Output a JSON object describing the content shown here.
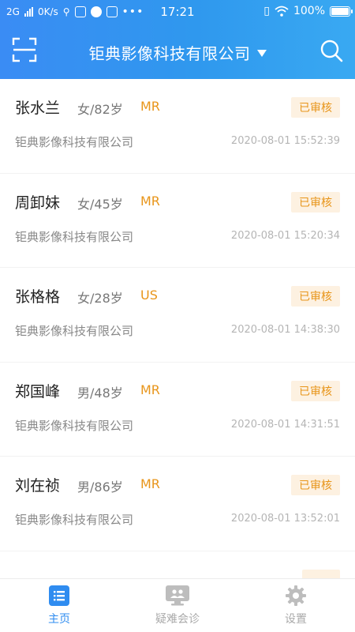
{
  "status_bar": {
    "network": "2G",
    "speed": "0K/s",
    "time": "17:21",
    "battery": "100%"
  },
  "header": {
    "title": "钜典影像科技有限公司"
  },
  "colors": {
    "header_gradient_start": "#3a8cf4",
    "header_gradient_end": "#39a9f2",
    "accent": "#2f8cf0",
    "modality": "#e8951a",
    "badge_bg": "#fdf1e1"
  },
  "icons": {
    "scan": "scan-icon",
    "search": "search-icon",
    "home": "list-icon",
    "consult": "monitor-icon",
    "settings": "gear-icon"
  },
  "records": [
    {
      "name": "张水兰",
      "meta": "女/82岁",
      "modality": "MR",
      "status": "已审核",
      "org": "钜典影像科技有限公司",
      "time": "2020-08-01 15:52:39"
    },
    {
      "name": "周卸妹",
      "meta": "女/45岁",
      "modality": "MR",
      "status": "已审核",
      "org": "钜典影像科技有限公司",
      "time": "2020-08-01 15:20:34"
    },
    {
      "name": "张格格",
      "meta": "女/28岁",
      "modality": "US",
      "status": "已审核",
      "org": "钜典影像科技有限公司",
      "time": "2020-08-01 14:38:30"
    },
    {
      "name": "郑国峰",
      "meta": "男/48岁",
      "modality": "MR",
      "status": "已审核",
      "org": "钜典影像科技有限公司",
      "time": "2020-08-01 14:31:51"
    },
    {
      "name": "刘在祯",
      "meta": "男/86岁",
      "modality": "MR",
      "status": "已审核",
      "org": "钜典影像科技有限公司",
      "time": "2020-08-01 13:52:01"
    }
  ],
  "tabbar": {
    "home": "主页",
    "consult": "疑难会诊",
    "settings": "设置"
  }
}
